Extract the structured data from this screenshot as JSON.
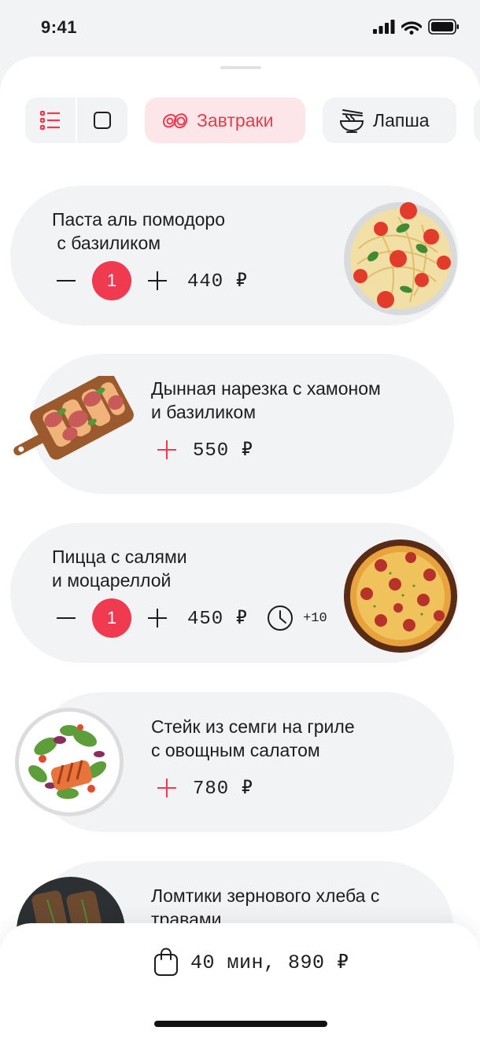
{
  "status": {
    "time": "9:41"
  },
  "categories": {
    "active": {
      "label": "Завтраки",
      "icon": "eggs-icon"
    },
    "next": {
      "label": "Лапша",
      "icon": "noodle-bowl-icon"
    }
  },
  "accent_color": "#ef3a4f",
  "items": [
    {
      "title": "Паста аль помодоро\n с базиликом",
      "quantity": "1",
      "price": "440 ₽",
      "image": "pasta-pomodoro"
    },
    {
      "title": "Дынная нарезка с хамоном\nи базиликом",
      "price": "550 ₽",
      "image": "melon-jamon-board"
    },
    {
      "title": "Пицца с салями\nи моцареллой",
      "quantity": "1",
      "price": "450 ₽",
      "extra_time": "+10",
      "image": "salami-pizza"
    },
    {
      "title": "Стейк из семги на гриле\nс овощным салатом",
      "price": "780 ₽",
      "image": "salmon-salad"
    },
    {
      "title": "Ломтики зернового хлеба с\nтравами",
      "image": "grain-bread"
    }
  ],
  "cart": {
    "summary": "40 мин, 890 ₽",
    "icon": "shopping-bag-icon"
  }
}
